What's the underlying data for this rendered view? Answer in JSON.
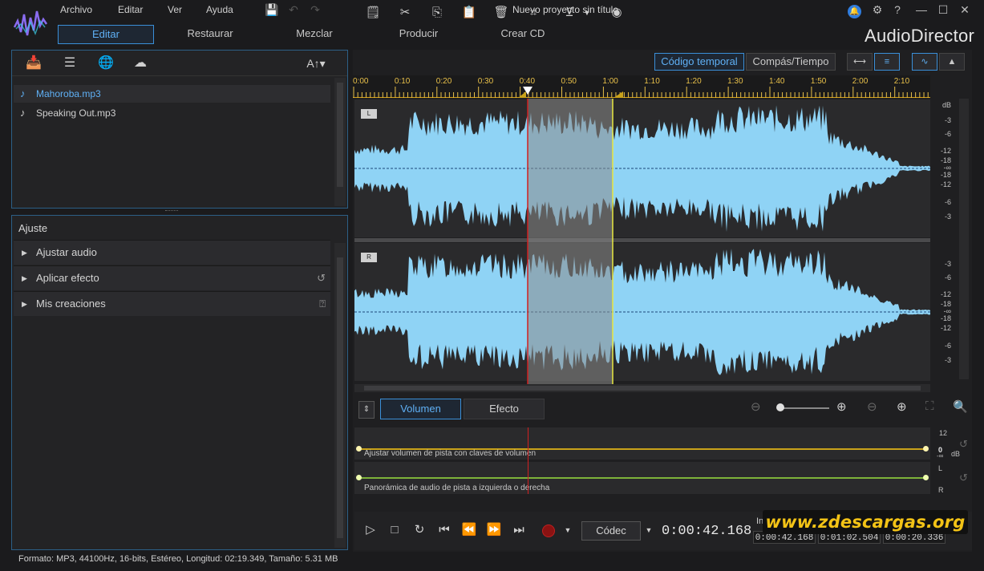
{
  "window": {
    "title": "Nuevo proyecto sin título",
    "brand": "AudioDirector"
  },
  "menu": [
    "Archivo",
    "Editar",
    "Ver",
    "Ayuda"
  ],
  "main_tabs": [
    "Editar",
    "Restaurar",
    "Mezclar",
    "Producir",
    "Crear CD"
  ],
  "files": {
    "font_button": "A↑▾",
    "items": [
      "Mahoroba.mp3",
      "Speaking Out.mp3"
    ]
  },
  "adjust": {
    "title": "Ajuste",
    "items": [
      "Ajustar audio",
      "Aplicar efecto",
      "Mis creaciones"
    ]
  },
  "timeline": {
    "mode_codigo": "Código temporal",
    "mode_compas": "Compás/Tiempo",
    "ticks": [
      "0:00",
      "0:10",
      "0:20",
      "0:30",
      "0:40",
      "0:50",
      "1:00",
      "1:10",
      "1:20",
      "1:30",
      "1:40",
      "1:50",
      "2:00",
      "2:10"
    ],
    "channel_left": "L",
    "channel_right": "R",
    "db_unit": "dB",
    "db_labels": [
      "-3",
      "-6",
      "-12",
      "-18",
      "-∞",
      "-18",
      "-12",
      "-6",
      "-3"
    ]
  },
  "bottom_tabs": {
    "volume": "Volumen",
    "effect": "Efecto"
  },
  "lanes": {
    "volume_label": "Ajustar volumen de pista con claves de volumen",
    "volume_scale": [
      "12",
      "0",
      "-∞",
      "dB"
    ],
    "pan_label": "Panorámica de audio de pista a izquierda o derecha",
    "pan_scale": [
      "L",
      "R"
    ]
  },
  "transport": {
    "codec": "Códec",
    "current_time": "0:00:42.168",
    "in_label": "In",
    "times": [
      "0:00:42.168",
      "0:01:02.504",
      "0:00:20.336"
    ]
  },
  "watermark": "www.zdescargas.org",
  "status": "Formato: MP3, 44100Hz, 16-bits, Estéreo, Longitud: 02:19.349, Tamaño: 5.31 MB",
  "colors": {
    "accent": "#3a8fd8",
    "waveform": "#8fd3f5",
    "selection": "#8a8a8a",
    "playhead": "#d02020",
    "cursor": "#e8e840"
  }
}
